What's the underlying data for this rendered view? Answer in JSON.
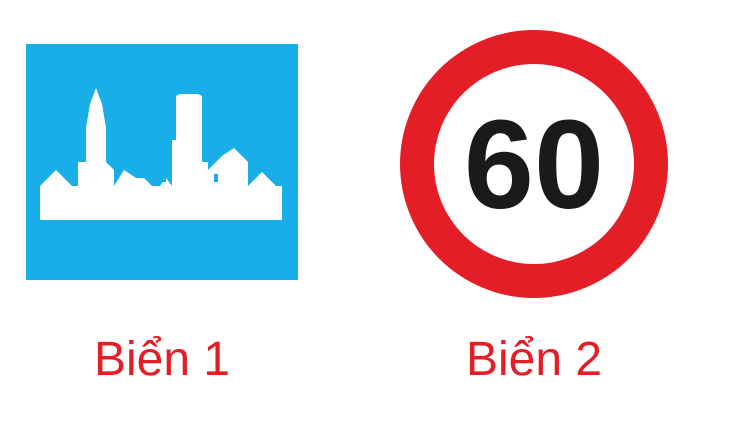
{
  "signs": [
    {
      "caption": "Biển 1",
      "icon": "city-skyline-icon",
      "background_color": "#1aaee8",
      "symbol_color": "#ffffff"
    },
    {
      "caption": "Biển 2",
      "icon": "speed-limit-icon",
      "speed_value": "60",
      "ring_color": "#e41e26",
      "inner_color": "#ffffff",
      "text_color": "#1a1a1a"
    }
  ],
  "caption_color": "#e41e26"
}
